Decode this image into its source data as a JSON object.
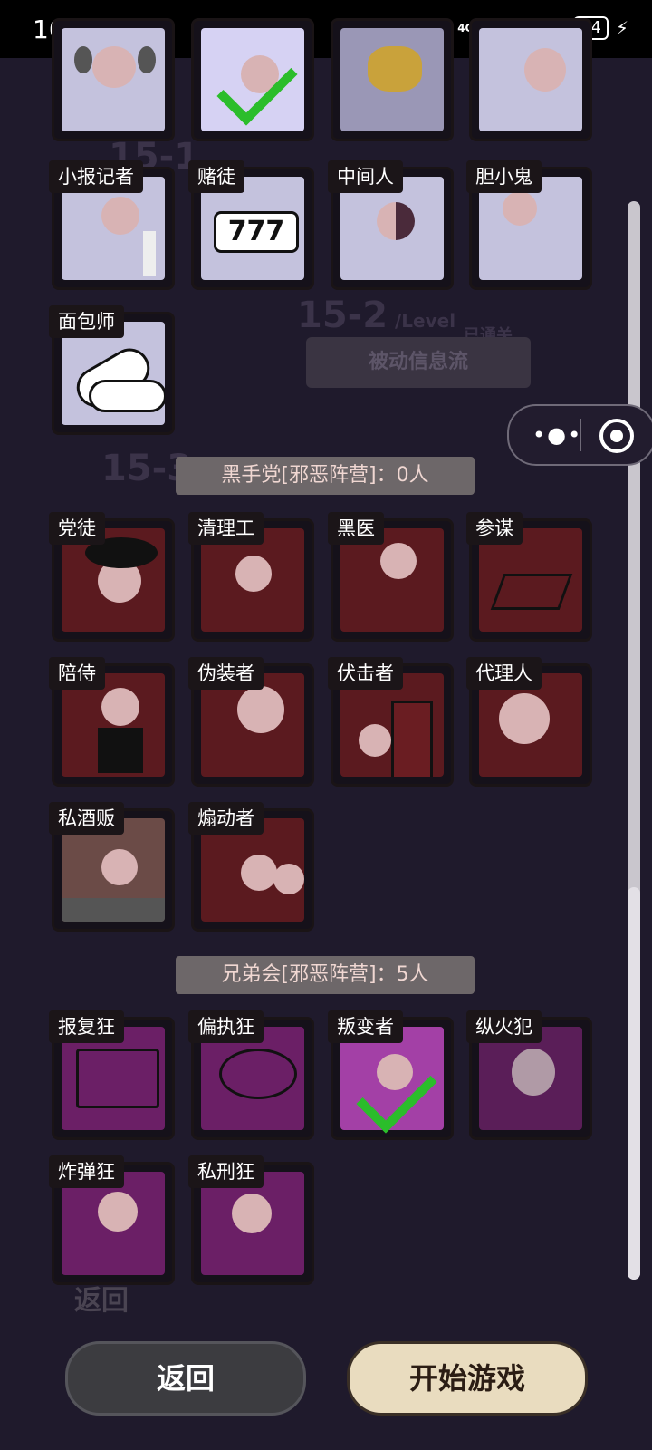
{
  "status_bar": {
    "time": "10:39",
    "signal_1": "4G",
    "signal_2": "4G",
    "battery": "74"
  },
  "background_text": {
    "level_15_1": "15-1",
    "level_15_2": "15-2",
    "level_15_3": "15-3",
    "level_unit": "/Level",
    "passed": "已通关",
    "level_15_2_name": "被动信息流",
    "back_ghost": "返回"
  },
  "rows_top": [
    {
      "label": "",
      "checked": false
    },
    {
      "label": "",
      "checked": true
    },
    {
      "label": "",
      "checked": false
    },
    {
      "label": "",
      "checked": false
    }
  ],
  "neutral": [
    {
      "label": "小报记者",
      "icon": "reporter-icon"
    },
    {
      "label": "赌徒",
      "icon": "slot-777-icon"
    },
    {
      "label": "中间人",
      "icon": "angel-devil-icon"
    },
    {
      "label": "胆小鬼",
      "icon": "coward-icon"
    },
    {
      "label": "面包师",
      "icon": "bread-icon"
    }
  ],
  "mafia": {
    "title": "黑手党[邪恶阵营]：0人",
    "roles": [
      {
        "label": "党徒",
        "icon": "hat-icon"
      },
      {
        "label": "清理工",
        "icon": "cleaner-icon"
      },
      {
        "label": "黑医",
        "icon": "doctor-icon"
      },
      {
        "label": "参谋",
        "icon": "pen-paper-icon"
      },
      {
        "label": "陪侍",
        "icon": "waiter-icon"
      },
      {
        "label": "伪装者",
        "icon": "mask-icon"
      },
      {
        "label": "伏击者",
        "icon": "door-icon"
      },
      {
        "label": "代理人",
        "icon": "agent-icon"
      },
      {
        "label": "私酒贩",
        "icon": "bar-icon"
      },
      {
        "label": "煽动者",
        "icon": "crowd-icon"
      }
    ]
  },
  "brotherhood": {
    "title": "兄弟会[邪恶阵营]：5人",
    "roles": [
      {
        "label": "报复狂",
        "icon": "book-knife-icon",
        "checked": false
      },
      {
        "label": "偏执狂",
        "icon": "thought-knife-icon",
        "checked": false
      },
      {
        "label": "叛变者",
        "icon": "traitor-icon",
        "checked": true
      },
      {
        "label": "纵火犯",
        "icon": "skull-icon",
        "checked": false
      },
      {
        "label": "炸弹狂",
        "icon": "bomber-icon",
        "checked": false
      },
      {
        "label": "私刑狂",
        "icon": "cuffs-icon",
        "checked": false
      }
    ]
  },
  "buttons": {
    "back": "返回",
    "start": "开始游戏"
  }
}
